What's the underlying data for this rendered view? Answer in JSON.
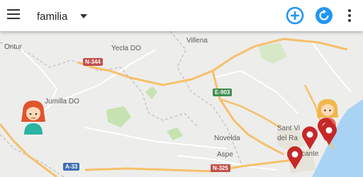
{
  "toolbar": {
    "menu_icon": "hamburger-menu-icon",
    "group_value": "familia",
    "dropdown_icon": "caret-down-icon",
    "add_icon": "add-circle-icon",
    "refresh_icon": "refresh-circle-icon",
    "more_icon": "more-vert-icon",
    "accent_color": "#2196f3"
  },
  "map": {
    "places": [
      "Ontur",
      "Yecla DO",
      "Villena",
      "Jumilla DO",
      "Novelda",
      "Aspe",
      "Sant Vi",
      "del Ra",
      "cante"
    ],
    "roads": [
      "N-344",
      "E-903",
      "A-33",
      "N-325"
    ],
    "members": [
      "family-member-avatar-girl",
      "family-member-avatar-blonde"
    ],
    "location_pins": 4
  }
}
